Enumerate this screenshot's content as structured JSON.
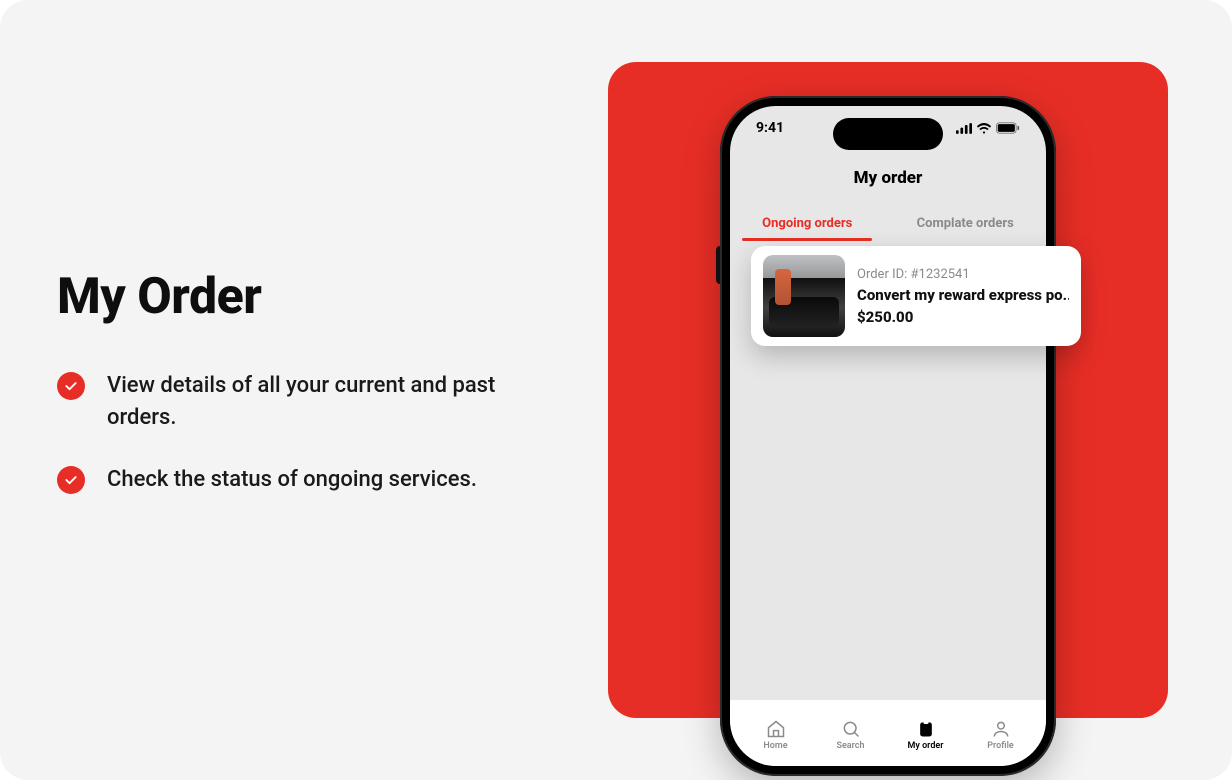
{
  "left": {
    "heading": "My Order",
    "bullets": [
      "View details of all your current and past orders.",
      "Check the status of ongoing services."
    ]
  },
  "phone": {
    "status": {
      "time": "9:41"
    },
    "title": "My order",
    "tabs": [
      {
        "label": "Ongoing orders",
        "active": true
      },
      {
        "label": "Complate orders",
        "active": false
      }
    ],
    "order": {
      "id_line": "Order ID: #1232541",
      "title": "Convert my reward express po..",
      "price": "$250.00"
    },
    "nav": [
      {
        "label": "Home"
      },
      {
        "label": "Search"
      },
      {
        "label": "My order",
        "active": true
      },
      {
        "label": "Profile"
      }
    ]
  },
  "colors": {
    "accent": "#e72e26",
    "bg": "#f4f4f4"
  }
}
